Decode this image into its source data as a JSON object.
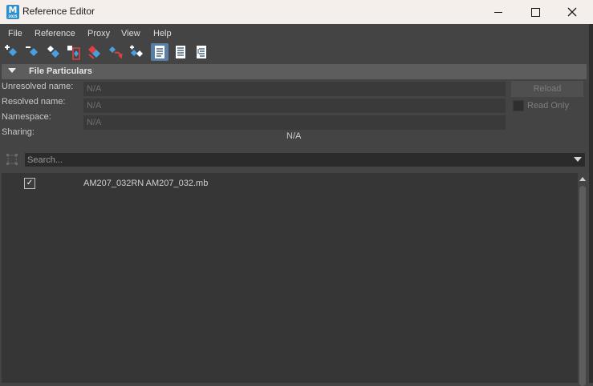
{
  "window": {
    "title": "Reference Editor",
    "app_icon_letter": "M",
    "app_icon_sub": "2025"
  },
  "menu": [
    "File",
    "Reference",
    "Proxy",
    "View",
    "Help"
  ],
  "toolbar": {
    "icons": [
      "add-reference-icon",
      "remove-reference-icon",
      "reload-reference-icon",
      "lock-reference-icon",
      "unload-reference-icon",
      "reference-action-icon",
      "merge-reference-icon",
      "list-view-icon",
      "details-view-icon",
      "hierarchy-view-icon"
    ]
  },
  "file_particulars": {
    "header": "File Particulars",
    "unresolved_label": "Unresolved name:",
    "unresolved_value": "N/A",
    "resolved_label": "Resolved name:",
    "resolved_value": "N/A",
    "namespace_label": "Namespace:",
    "namespace_value": "N/A",
    "sharing_label": "Sharing:",
    "sharing_value": "N/A",
    "reload_label": "Reload",
    "readonly_label": "Read Only"
  },
  "search": {
    "placeholder": "Search..."
  },
  "references": [
    {
      "name": "AM207_032RN AM207_032.mb",
      "checked": true
    }
  ],
  "colors": {
    "background": "#444444",
    "titlebar": "#f5efec",
    "section_header": "#5d5d5d",
    "active_toolbar": "#5a7fa6",
    "list_bg": "#363636"
  }
}
